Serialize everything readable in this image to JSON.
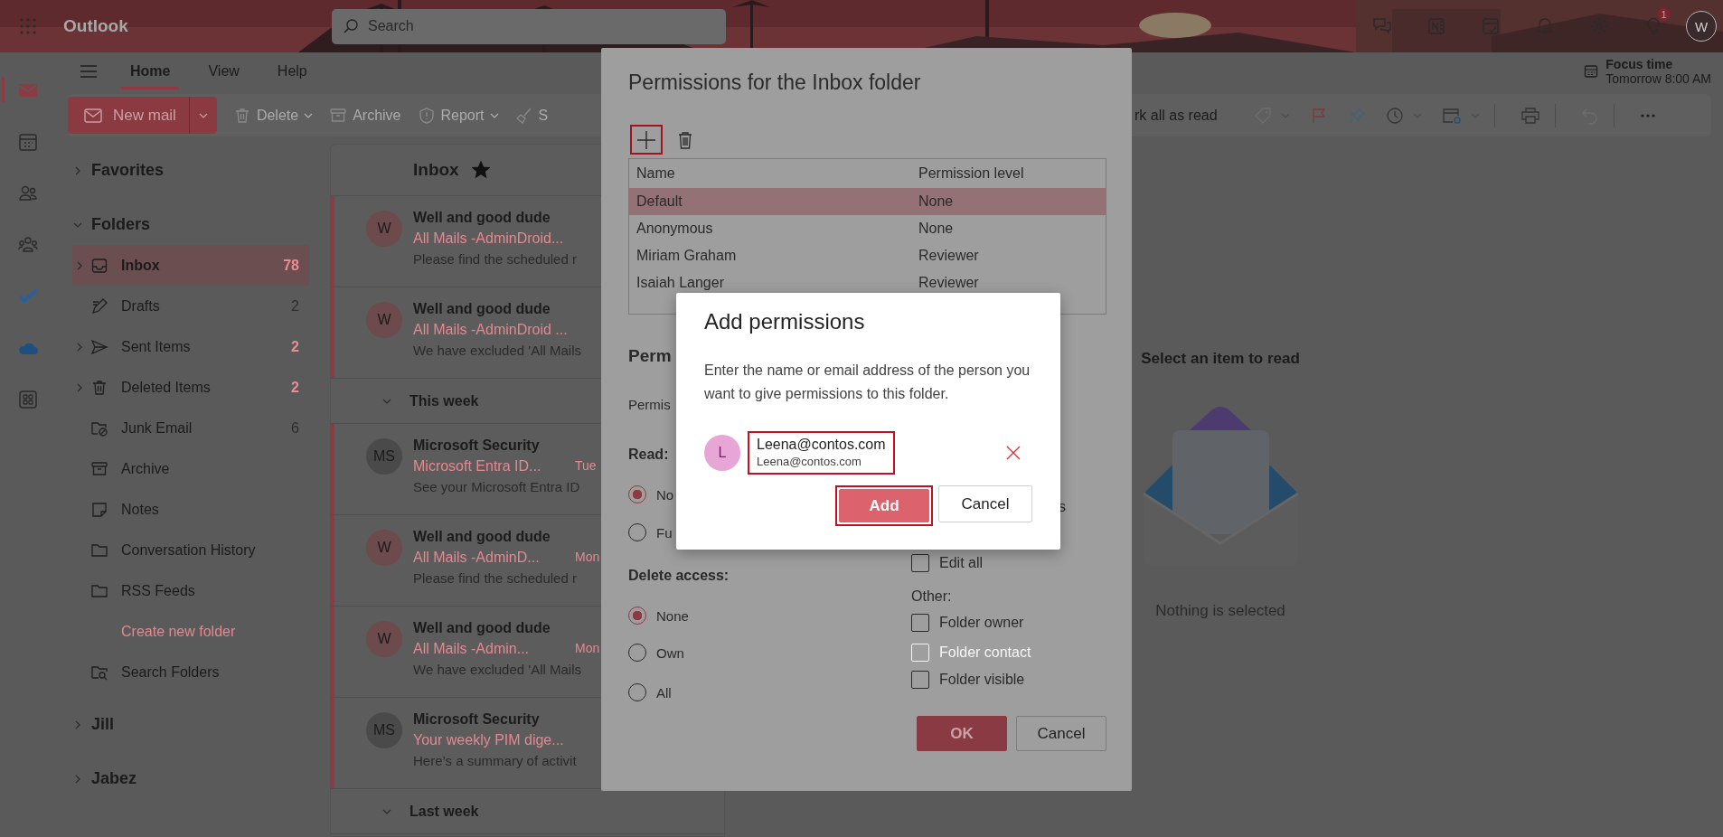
{
  "topbar": {
    "app_name": "Outlook",
    "search": {
      "placeholder": "Search"
    },
    "notification_badge": "1",
    "avatar": "W"
  },
  "rail": [
    {
      "kind": "mail",
      "selected": true
    },
    {
      "kind": "calendar",
      "selected": false
    },
    {
      "kind": "people",
      "selected": false
    },
    {
      "kind": "groups",
      "selected": false
    },
    {
      "kind": "todo",
      "selected": false
    },
    {
      "kind": "cloud",
      "selected": false
    },
    {
      "kind": "apps",
      "selected": false
    }
  ],
  "ribbon": {
    "tabs": [
      {
        "label": "Home",
        "selected": true
      },
      {
        "label": "View",
        "selected": false
      },
      {
        "label": "Help",
        "selected": false
      }
    ],
    "focus": {
      "title": "Focus time",
      "time": "Tomorrow 8:00 AM"
    }
  },
  "toolbar": {
    "new_mail": "New mail",
    "left_items": [
      {
        "kind": "delete",
        "label": "Delete",
        "menu": true
      },
      {
        "kind": "archive",
        "label": "Archive",
        "menu": false
      },
      {
        "kind": "report",
        "label": "Report",
        "menu": true
      },
      {
        "kind": "sweep",
        "label": "S",
        "menu": false
      }
    ],
    "right_label": "rk all as read"
  },
  "folder_pane": {
    "groups": [
      {
        "label": "Favorites",
        "expanded": false
      },
      {
        "label": "Folders",
        "expanded": true,
        "children": [
          {
            "kind": "inbox",
            "label": "Inbox",
            "count": "78",
            "unread": true,
            "selected": true,
            "expandable": true
          },
          {
            "kind": "drafts",
            "label": "Drafts",
            "count": "2",
            "unread": false,
            "selected": false,
            "expandable": false
          },
          {
            "kind": "sent",
            "label": "Sent Items",
            "count": "2",
            "unread": true,
            "selected": false,
            "expandable": true
          },
          {
            "kind": "deleted",
            "label": "Deleted Items",
            "count": "2",
            "unread": true,
            "selected": false,
            "expandable": true
          },
          {
            "kind": "junk",
            "label": "Junk Email",
            "count": "6",
            "unread": false,
            "selected": false,
            "expandable": false
          },
          {
            "kind": "archive",
            "label": "Archive",
            "selected": false,
            "expandable": false
          },
          {
            "kind": "notes",
            "label": "Notes",
            "selected": false,
            "expandable": false
          },
          {
            "kind": "folder",
            "label": "Conversation History",
            "selected": false,
            "expandable": false
          },
          {
            "kind": "folder",
            "label": "RSS Feeds",
            "selected": false,
            "expandable": false
          },
          {
            "kind": "link",
            "label": "Create new folder",
            "selected": false,
            "expandable": false
          },
          {
            "kind": "search_folder",
            "label": "Search Folders",
            "selected": false,
            "expandable": false
          }
        ]
      },
      {
        "label": "Jill",
        "expanded": false
      },
      {
        "label": "Jabez",
        "expanded": false
      }
    ]
  },
  "message_list": {
    "title": "Inbox",
    "favorite": true,
    "entries": [
      {
        "kind": "message",
        "avatar": "W",
        "color": "#6d4a4b",
        "sender": "Well and good dude",
        "subject": "All Mails -AdminDroid...",
        "preview": "Please find the scheduled r",
        "unread": true
      },
      {
        "kind": "message",
        "avatar": "W",
        "color": "#6d4a4b",
        "sender": "Well and good dude",
        "subject": "All Mails -AdminDroid ...",
        "preview": "We have excluded 'All Mails",
        "unread": true
      },
      {
        "kind": "group",
        "label": "This week",
        "expanded": true
      },
      {
        "kind": "message",
        "avatar": "MS",
        "color": "#4a4a4a",
        "sender": "Microsoft Security",
        "subject": "Microsoft Entra ID...",
        "date": "Tue",
        "preview": "See your Microsoft Entra ID",
        "unread": true
      },
      {
        "kind": "message",
        "avatar": "W",
        "color": "#6d4a4b",
        "sender": "Well and good dude",
        "subject": "All Mails -AdminD...",
        "date": "Mon",
        "preview": "Please find the scheduled r",
        "unread": true
      },
      {
        "kind": "message",
        "avatar": "W",
        "color": "#6d4a4b",
        "sender": "Well and good dude",
        "subject": "All Mails -Admin...",
        "date": "Mon",
        "preview": "We have excluded 'All Mails",
        "unread": true
      },
      {
        "kind": "message",
        "avatar": "MS",
        "color": "#4a4a4a",
        "sender": "Microsoft Security",
        "subject": "Your weekly PIM dige...",
        "preview": "Here’s a summary of activit",
        "unread": true
      },
      {
        "kind": "group",
        "label": "Last week",
        "expanded": true
      }
    ]
  },
  "reading_pane": {
    "title": "Select an item to read",
    "message": "Nothing is selected"
  },
  "permissions_dialog": {
    "title": "Permissions for the Inbox folder",
    "table": {
      "columns": [
        "Name",
        "Permission level"
      ],
      "rows": [
        {
          "name": "Default",
          "permission": "None",
          "selected": true
        },
        {
          "name": "Anonymous",
          "permission": "None",
          "selected": false
        },
        {
          "name": "Miriam Graham",
          "permission": "Reviewer",
          "selected": false
        },
        {
          "name": "Isaiah Langer",
          "permission": "Reviewer",
          "selected": false
        }
      ]
    },
    "heading": "Perm",
    "permission_label": "Permis",
    "read": {
      "label": "Read:",
      "options": [
        {
          "label": "No",
          "selected": true
        },
        {
          "label": "Fu",
          "selected": false
        }
      ]
    },
    "delete": {
      "label": "Delete access:",
      "options": [
        {
          "label": "None",
          "selected": true
        },
        {
          "label": "Own",
          "selected": false
        },
        {
          "label": "All",
          "selected": false
        }
      ]
    },
    "write_fragment": "s",
    "edit_all": {
      "label": "Edit all",
      "checked": false
    },
    "other": {
      "label": "Other:",
      "options": [
        {
          "label": "Folder owner",
          "checked": false,
          "disabled": false
        },
        {
          "label": "Folder contact",
          "checked": false,
          "disabled": true
        },
        {
          "label": "Folder visible",
          "checked": false,
          "disabled": false
        }
      ]
    },
    "buttons": [
      {
        "label": "OK",
        "kind": "primary"
      },
      {
        "label": "Cancel",
        "kind": "secondary"
      }
    ]
  },
  "add_dialog": {
    "title": "Add permissions",
    "description": "Enter the name or email address of the person you want to give permissions to this folder.",
    "person": {
      "initial": "L",
      "name": "Leena@contos.com",
      "email": "Leena@contos.com"
    },
    "buttons": [
      {
        "label": "Add",
        "kind": "primary"
      },
      {
        "label": "Cancel",
        "kind": "secondary"
      }
    ]
  }
}
